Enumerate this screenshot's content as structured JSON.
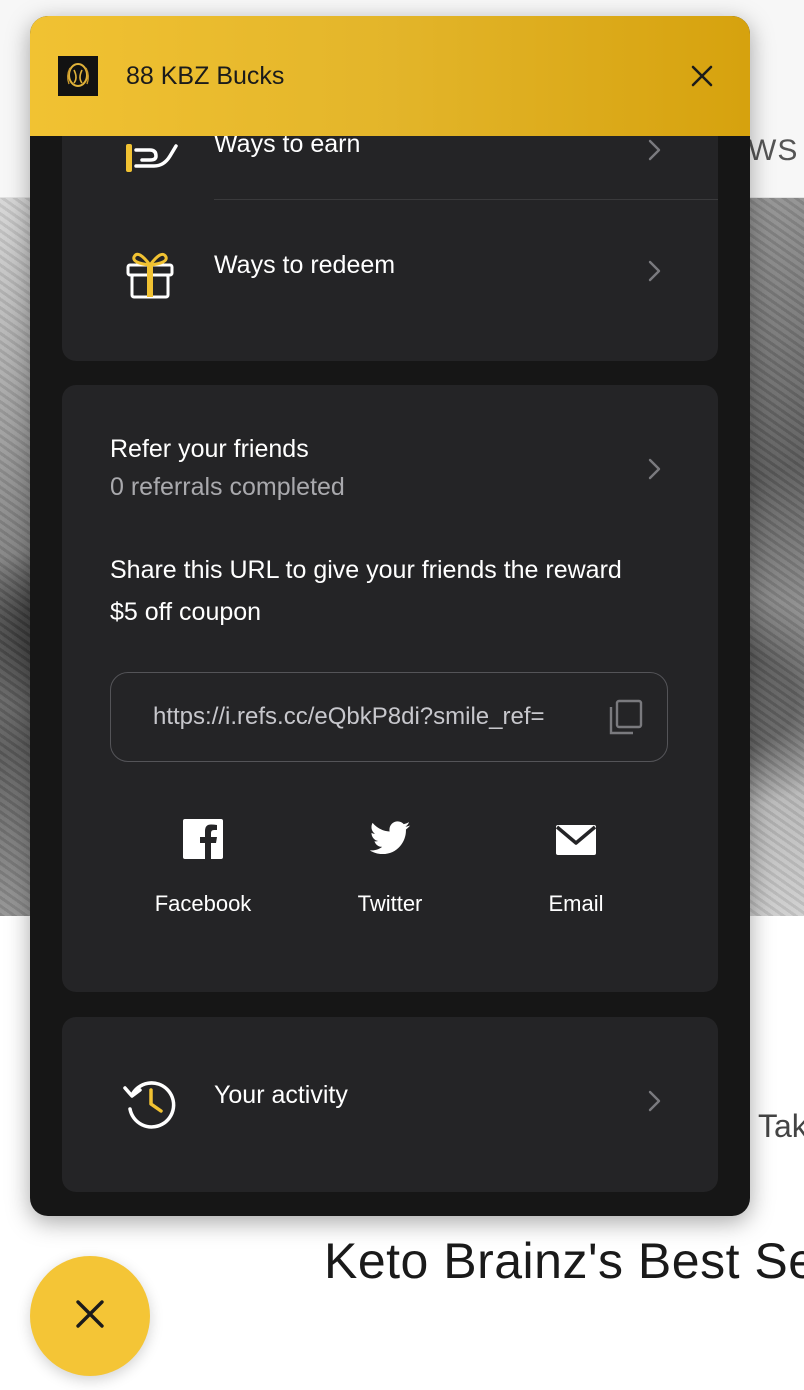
{
  "colors": {
    "accent": "#f1c232",
    "panel_bg": "#161616",
    "card_bg": "#242426",
    "muted_text": "#a9a9ad"
  },
  "background_page": {
    "nav_fragment": "WS",
    "side_fragment": "Tak",
    "best_sellers_title": "Keto Brainz's Best Se"
  },
  "panel": {
    "title": "88 KBZ Bucks",
    "logo_icon": "kbz-logo-icon",
    "close_icon": "close-icon"
  },
  "menu": {
    "ways_to_earn": {
      "label": "Ways to earn",
      "icon": "hand-coin-icon"
    },
    "ways_to_redeem": {
      "label": "Ways to redeem",
      "icon": "gift-icon"
    }
  },
  "referral": {
    "title": "Refer your friends",
    "subtitle": "0 referrals completed",
    "share_text": "Share this URL to give your friends the reward $5 off coupon",
    "url": "https://i.refs.cc/eQbkP8di?smile_ref=",
    "copy_icon": "copy-icon",
    "share_buttons": [
      {
        "label": "Facebook",
        "icon": "facebook-icon"
      },
      {
        "label": "Twitter",
        "icon": "twitter-icon"
      },
      {
        "label": "Email",
        "icon": "email-icon"
      }
    ]
  },
  "activity": {
    "label": "Your activity",
    "icon": "history-clock-icon"
  },
  "launcher": {
    "icon": "close-icon"
  }
}
